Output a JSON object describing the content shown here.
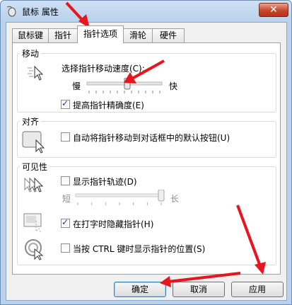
{
  "window": {
    "title": "鼠标 属性",
    "close_label": "✕"
  },
  "tabs": [
    {
      "label": "鼠标键"
    },
    {
      "label": "指针"
    },
    {
      "label": "指针选项",
      "active": true
    },
    {
      "label": "滑轮"
    },
    {
      "label": "硬件"
    }
  ],
  "motion": {
    "title": "移动",
    "speed_label": "选择指针移动速度(C):",
    "slow": "慢",
    "fast": "快",
    "speed_level": 0.54,
    "precision_label": "提高指针精确度(E)",
    "precision_checked": true
  },
  "snap": {
    "title": "对齐",
    "snap_label": "自动将指针移动到对话框中的默认按钮(U)",
    "snap_checked": false
  },
  "visibility": {
    "title": "可见性",
    "trails_label": "显示指针轨迹(D)",
    "trails_checked": false,
    "short": "短",
    "long": "长",
    "trails_level": 1.0,
    "hide_typing_label": "在打字时隐藏指针(H)",
    "hide_typing_checked": true,
    "ctrl_label": "当按 CTRL 键时显示指针的位置(S)",
    "ctrl_checked": false
  },
  "buttons": {
    "ok": "确定",
    "cancel": "取消",
    "apply": "应用"
  },
  "colors": {
    "annotation_arrow": "#e8141e",
    "accent": "#3c7fb1"
  }
}
